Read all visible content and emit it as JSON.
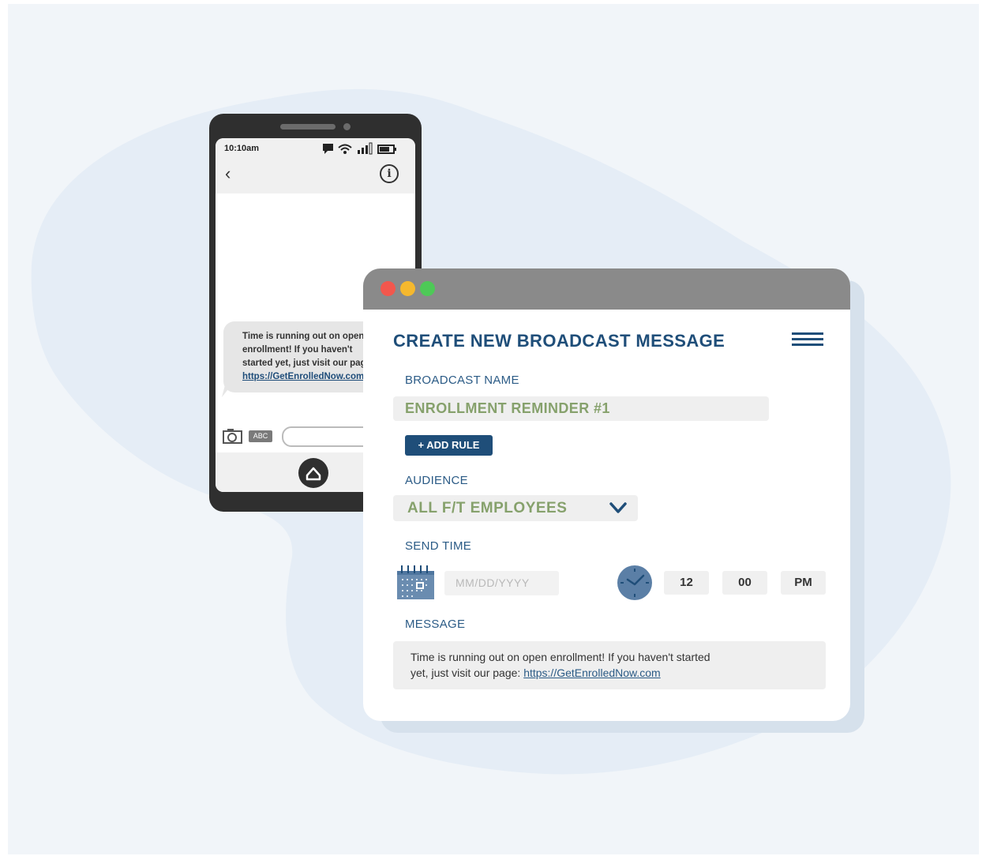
{
  "phone": {
    "status_time": "10:10am",
    "back_icon": "chevron-left-icon",
    "info_icon": "info-icon",
    "info_glyph": "i",
    "bubble_lines": [
      "Time is running out on open",
      "enrollment! If you haven't",
      "started yet, just visit our page:",
      "https://GetEnrolledNow.com"
    ],
    "abc_label": "ABC"
  },
  "window": {
    "traffic_lights": [
      "#f2574d",
      "#f5b82e",
      "#4ec957"
    ],
    "title": "CREATE NEW BROADCAST MESSAGE",
    "broadcast_name_label": "BROADCAST NAME",
    "broadcast_name_value": "ENROLLMENT REMINDER #1",
    "add_rule_label": "+ ADD RULE",
    "audience_label": "AUDIENCE",
    "audience_value": "ALL F/T EMPLOYEES",
    "send_time_label": "SEND TIME",
    "date_placeholder": "MM/DD/YYYY",
    "hour": "12",
    "minute": "00",
    "ampm": "PM",
    "message_label": "MESSAGE",
    "message_line1": "Time is running out on open enrollment! If you haven't started",
    "message_line2_prefix": "yet, just visit our page: ",
    "message_link": "https://GetEnrolledNow.com"
  },
  "colors": {
    "accent_navy": "#1f4e79",
    "value_green": "#86a16c",
    "label_blue": "#2b5b86",
    "canvas_bg": "#f1f5f9",
    "blob": "#e5edf6"
  }
}
